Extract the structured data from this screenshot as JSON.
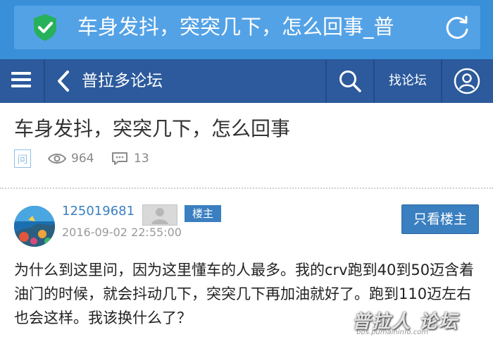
{
  "browser": {
    "url_title": "车身发抖，突突几下，怎么回事_普"
  },
  "nav": {
    "title": "普拉多论坛",
    "find_forum_label": "找论坛"
  },
  "thread": {
    "title": "车身发抖，突突几下，怎么回事",
    "type_badge": "问",
    "views": "964",
    "replies": "13"
  },
  "post": {
    "username": "125019681",
    "owner_badge": "楼主",
    "time": "2016-09-02 22:55:00",
    "only_owner_button": "只看楼主",
    "content": "为什么到这里问，因为这里懂车的人最多。我的crv跑到40到50迈含着油门的时候，就会抖动几下，突突几下再加油就好了。跑到110迈左右也会这样。我该换什么了？"
  },
  "watermark": {
    "main": "普拉人 论坛",
    "sub": "bbs.pumaininfo.com"
  },
  "colors": {
    "urlbar": "#3a8fd9",
    "navbar": "#2c5a9c",
    "accent": "#3a7fc0",
    "shield": "#27b15a"
  }
}
